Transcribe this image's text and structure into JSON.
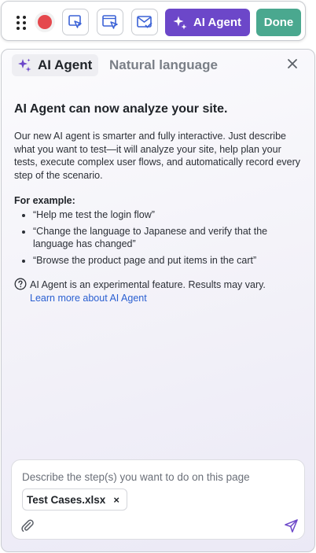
{
  "toolbar": {
    "agent_button_label": "AI Agent",
    "done_button_label": "Done"
  },
  "panel": {
    "tab_active": "AI Agent",
    "tab_inactive": "Natural language",
    "heading": "AI Agent can now analyze your site.",
    "description": "Our new AI agent is smarter and fully interactive. Just describe what you want to test—it will analyze your site, help plan your tests, execute complex user flows, and automatically record every step of the scenario.",
    "examples_title": "For example:",
    "examples": [
      "“Help me test the login flow”",
      "“Change the language to Japanese and verify that the language has changed”",
      "“Browse the product page and put items in the cart”"
    ],
    "notice": "AI Agent is an experimental feature. Results may vary.",
    "learn_more": "Learn more about AI Agent"
  },
  "composer": {
    "placeholder": "Describe the step(s) you want to do on this page",
    "attachment_name": "Test Cases.xlsx",
    "attachment_remove": "×"
  },
  "colors": {
    "accent": "#6c47c9",
    "done": "#4aa88f",
    "record": "#e5484d",
    "link": "#2a5fd1"
  }
}
